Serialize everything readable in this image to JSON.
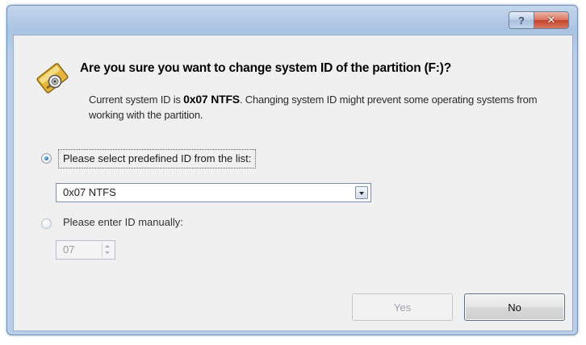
{
  "window": {
    "help_label": "?",
    "close_label": "✕"
  },
  "dialog": {
    "icon": "partition-drive-icon",
    "headline": "Are you sure you want to change system ID of the partition (F:)?",
    "desc_prefix": "Current system ID is ",
    "desc_current_id": "0x07 NTFS",
    "desc_suffix": ". Changing system ID might prevent some operating systems from working with the partition."
  },
  "options": {
    "predefined": {
      "label": "Please select predefined ID from the list:",
      "checked": true,
      "selected_value": "0x07 NTFS"
    },
    "manual": {
      "label": "Please enter ID manually:",
      "checked": false,
      "value": "07"
    }
  },
  "buttons": {
    "yes_label": "Yes",
    "yes_enabled": false,
    "no_label": "No"
  },
  "colors": {
    "accent": "#14539c",
    "close": "#c4432b",
    "frame": "#b9cfe9"
  }
}
